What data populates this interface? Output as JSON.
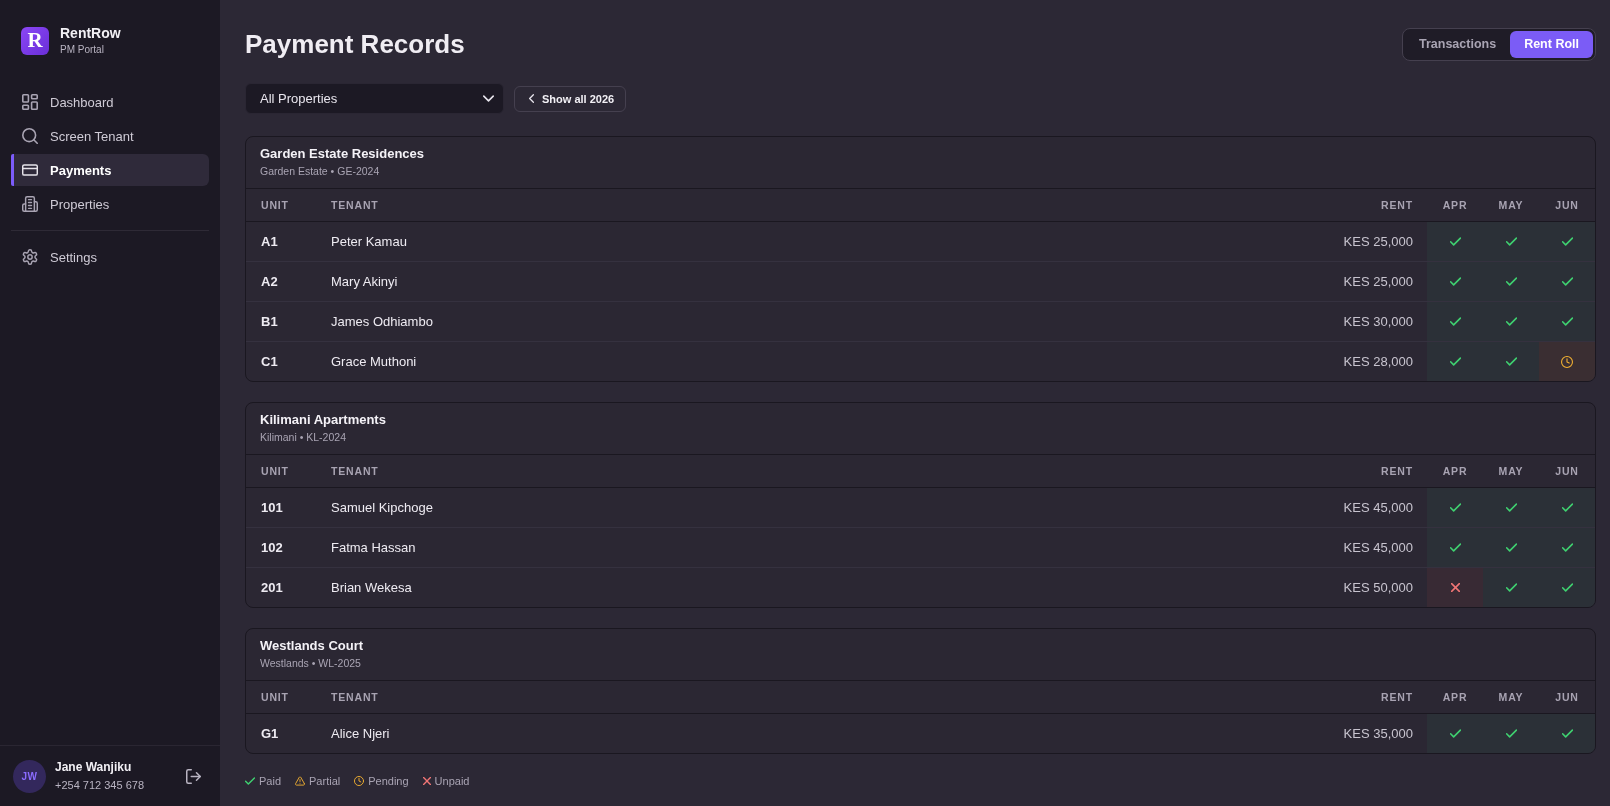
{
  "sidebar": {
    "brand": {
      "logo_letter": "R",
      "name": "RentRow",
      "subtitle": "PM Portal"
    },
    "nav_items": [
      {
        "label": "Dashboard",
        "selected": false
      },
      {
        "label": "Screen Tenant",
        "selected": false
      },
      {
        "label": "Payments",
        "selected": true
      },
      {
        "label": "Properties",
        "selected": false
      }
    ],
    "secondary_items": [
      {
        "label": "Settings",
        "selected": false
      }
    ],
    "user": {
      "initials": "JW",
      "name": "Jane Wanjiku",
      "phone": "+254 712 345 678"
    }
  },
  "header": {
    "title": "Payment Records",
    "view_tabs": [
      {
        "label": "Transactions",
        "selected": false
      },
      {
        "label": "Rent Roll",
        "selected": true
      }
    ]
  },
  "filters": {
    "property_select": {
      "value": "All Properties"
    },
    "show_all_button": {
      "label": "Show all 2026"
    }
  },
  "properties": [
    {
      "name": "Garden Estate Residences",
      "subtitle": "Garden Estate • GE-2024",
      "columns": [
        "UNIT",
        "TENANT",
        "RENT",
        "APR",
        "MAY",
        "JUN"
      ],
      "rows": [
        {
          "unit": "A1",
          "tenant": "Peter Kamau",
          "rent": "KES 25,000",
          "payments": [
            {
              "kind": "paid"
            },
            {
              "kind": "paid"
            },
            {
              "kind": "paid"
            }
          ]
        },
        {
          "unit": "A2",
          "tenant": "Mary Akinyi",
          "rent": "KES 25,000",
          "payments": [
            {
              "kind": "paid"
            },
            {
              "kind": "paid"
            },
            {
              "kind": "paid"
            }
          ]
        },
        {
          "unit": "B1",
          "tenant": "James Odhiambo",
          "rent": "KES 30,000",
          "payments": [
            {
              "kind": "paid"
            },
            {
              "kind": "paid"
            },
            {
              "kind": "paid"
            }
          ]
        },
        {
          "unit": "C1",
          "tenant": "Grace Muthoni",
          "rent": "KES 28,000",
          "payments": [
            {
              "kind": "paid"
            },
            {
              "kind": "paid"
            },
            {
              "kind": "pending"
            }
          ]
        }
      ]
    },
    {
      "name": "Kilimani Apartments",
      "subtitle": "Kilimani • KL-2024",
      "columns": [
        "UNIT",
        "TENANT",
        "RENT",
        "APR",
        "MAY",
        "JUN"
      ],
      "rows": [
        {
          "unit": "101",
          "tenant": "Samuel Kipchoge",
          "rent": "KES 45,000",
          "payments": [
            {
              "kind": "paid"
            },
            {
              "kind": "paid"
            },
            {
              "kind": "paid"
            }
          ]
        },
        {
          "unit": "102",
          "tenant": "Fatma Hassan",
          "rent": "KES 45,000",
          "payments": [
            {
              "kind": "paid"
            },
            {
              "kind": "paid"
            },
            {
              "kind": "paid"
            }
          ]
        },
        {
          "unit": "201",
          "tenant": "Brian Wekesa",
          "rent": "KES 50,000",
          "payments": [
            {
              "kind": "unpaid"
            },
            {
              "kind": "paid"
            },
            {
              "kind": "paid"
            }
          ]
        }
      ]
    },
    {
      "name": "Westlands Court",
      "subtitle": "Westlands • WL-2025",
      "columns": [
        "UNIT",
        "TENANT",
        "RENT",
        "APR",
        "MAY",
        "JUN"
      ],
      "rows": [
        {
          "unit": "G1",
          "tenant": "Alice Njeri",
          "rent": "KES 35,000",
          "payments": [
            {
              "kind": "paid"
            },
            {
              "kind": "paid"
            },
            {
              "kind": "paid"
            }
          ]
        }
      ]
    }
  ],
  "legend": [
    {
      "kind": "paid",
      "label": "Paid"
    },
    {
      "kind": "partial",
      "label": "Partial"
    },
    {
      "kind": "pending",
      "label": "Pending"
    },
    {
      "kind": "unpaid",
      "label": "Unpaid"
    }
  ]
}
